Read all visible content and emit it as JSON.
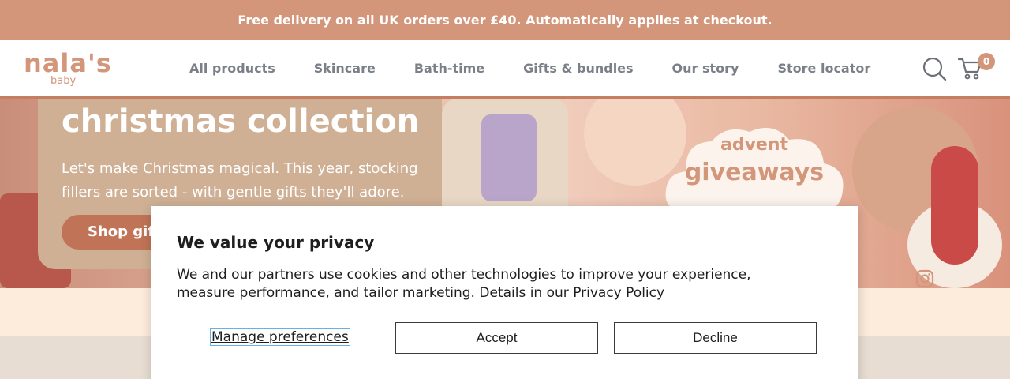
{
  "promo": {
    "text": "Free delivery on all UK orders over £40. Automatically applies at checkout."
  },
  "header": {
    "logo": {
      "main": "nala's",
      "sub": "baby"
    },
    "nav": [
      "All products",
      "Skincare",
      "Bath-time",
      "Gifts & bundles",
      "Our story",
      "Store locator"
    ],
    "cart_count": "0",
    "icons": {
      "search": "search-icon",
      "cart": "cart-icon"
    }
  },
  "hero": {
    "title": "christmas collection",
    "subtitle": "Let's make Christmas magical. This year, stocking fillers are sorted - with gentle gifts they'll adore.",
    "button_label": "Shop gifts",
    "advent_title": "advent",
    "advent_subtitle": "giveaways",
    "icons": {
      "social": "instagram-icon"
    }
  },
  "cookie_modal": {
    "title": "We value your privacy",
    "body": "We and our partners use cookies and other technologies to improve your experience, measure performance, and tailor marketing. Details in our",
    "link_text": "Privacy Policy",
    "manage_label": "Manage preferences",
    "accept_label": "Accept",
    "decline_label": "Decline"
  },
  "colors": {
    "brand": "#d4967a",
    "accent": "#c07356",
    "nav_text": "#7a7f88",
    "hero_card": "#cfb095",
    "band_light": "#fdebdc",
    "band_beige": "#e8ddd2"
  }
}
